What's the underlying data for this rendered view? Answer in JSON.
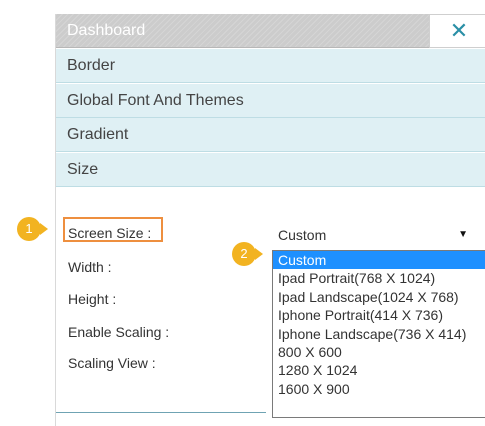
{
  "panel": {
    "title": "Dashboard",
    "close_icon": "close-icon"
  },
  "sections": [
    {
      "label": "Border"
    },
    {
      "label": "Global Font And Themes"
    },
    {
      "label": "Gradient"
    },
    {
      "label": "Size"
    }
  ],
  "form": {
    "screen_size_label": "Screen Size :",
    "width_label": "Width :",
    "height_label": "Height :",
    "enable_scaling_label": "Enable Scaling :",
    "scaling_view_label": "Scaling View :",
    "screen_size_value": "Custom",
    "select_arrow": "▼"
  },
  "dropdown": {
    "options": [
      "Custom",
      "Ipad Portrait(768 X 1024)",
      "Ipad Landscape(1024 X 768)",
      "Iphone Portrait(414 X 736)",
      "Iphone Landscape(736 X 414)",
      "800 X 600",
      "1280 X 1024",
      "1600 X 900"
    ],
    "selected": "Custom"
  },
  "callouts": {
    "step1": "1",
    "step2": "2"
  },
  "colors": {
    "accent": "#2a8fa6",
    "section_bg": "#dff0f4",
    "highlight": "#ee8f3f",
    "badge": "#f2b321",
    "selected_option": "#1e90ff"
  }
}
